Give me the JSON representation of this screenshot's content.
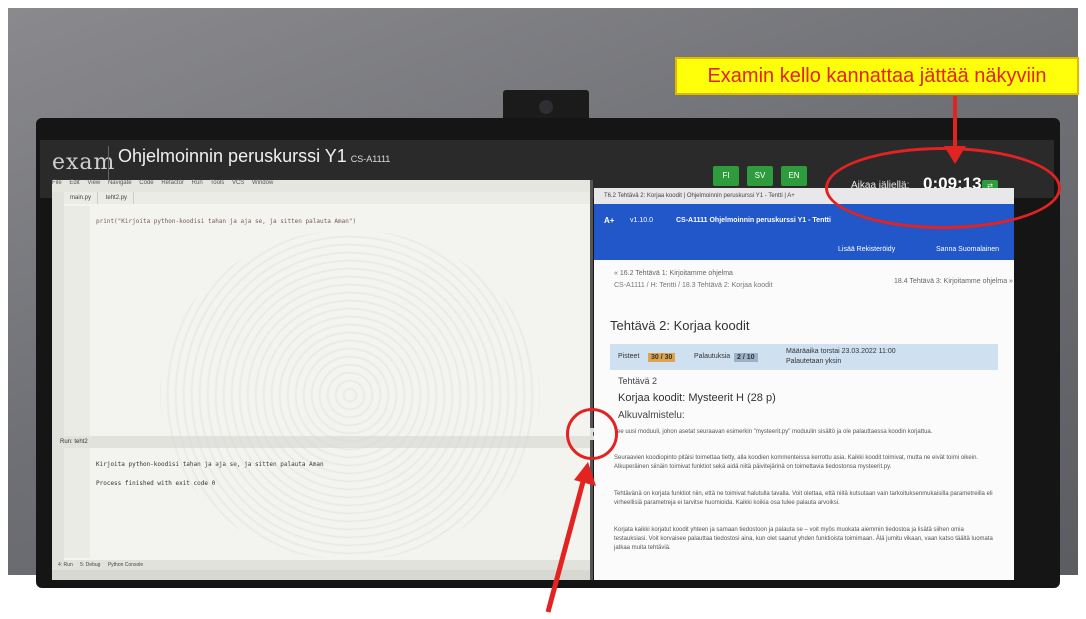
{
  "annotation": {
    "callout_text": "Examin kello kannattaa jättää näkyviin"
  },
  "exam": {
    "brand": "exam",
    "course_title": "Ohjelmoinnin peruskurssi Y1",
    "course_code": "CS-A1111",
    "languages": [
      "FI",
      "SV",
      "EN"
    ],
    "timer_label": "Aikaa jäljellä:",
    "timer_value": "0:09:13"
  },
  "ide": {
    "menu": [
      "File",
      "Edit",
      "View",
      "Navigate",
      "Code",
      "Refactor",
      "Run",
      "Tools",
      "VCS",
      "Window"
    ],
    "tabs": [
      "main.py",
      "teht2.py"
    ],
    "code_line": "print(\"Kirjoita python-koodisi tahan ja aja se, ja sitten palauta Aman\")",
    "run_tab": "Run: teht2",
    "output_lines": [
      "Kirjoita python-koodisi tahan ja aja se, ja sitten palauta Aman",
      "Process finished with exit code 0"
    ],
    "bottom_tabs": [
      "4: Run",
      "5: Debug",
      "Python Console"
    ]
  },
  "browser": {
    "window_title": "T6.2 Tehtävä 2: Korjaa koodit | Ohjelmoinnin peruskurssi Y1 - Tentti | A+",
    "logo": "A+",
    "version": "v1.10.0",
    "course": "CS-A1111 Ohjelmoinnin peruskurssi Y1 - Tentti",
    "language_menu": "Lisää Rekisteröidy",
    "user_menu": "Sanna Suomalainen",
    "crumb_prev": "« 16.2 Tehtävä 1: Kirjoitamme ohjelma",
    "crumb_next": "18.4 Tehtävä 3: Kirjoitamme ohjelma »",
    "crumb_path": "CS-A1111 / H: Tentti / 18.3 Tehtävä 2: Korjaa koodit",
    "heading": "Tehtävä 2: Korjaa koodit",
    "points_label": "Pisteet",
    "points_value": "30 / 30",
    "submissions_label": "Palautuksia",
    "submissions_value": "2 / 10",
    "deadline": "Määräaika torstai 23.03.2022 11:00",
    "group": "Palautetaan yksin",
    "task_label": "Tehtävä 2",
    "task_title": "Korjaa koodit: Mysteerit H (28 p)",
    "section": "Alkuvalmistelu:",
    "paragraphs": [
      "Tee uusi moduuli, johon asetat seuraavan esimerkin \"mysteerit.py\" moduulin sisältö ja ole palauttaessa koodin korjattua.",
      "Seuraavien koodiopinto pitäisi toimettaa tietty, alla koodien kommenteissa kerrottu asia. Kaikki koodit toimivat, mutta ne eivät toimi oikein. Alkuperäinen siinäin toimivat funktiot sekä aidä niitä päivitejärinä on toimettavia tiedostonsa mysteerit.py.",
      "Tehtävänä on korjata funktiot niin, että ne toimivat halutulla tavalla. Voit olettaa, että niitä kutsutaan vain tarkoituksenmukaisilla parametreilla eli virheellisiä parametreja ei tarvitse huomioida. Kaikki koikia osa tulee palauta arvoiksi.",
      "Korjata kaikki korjatut koodit yhteen ja samaan tiedostoon ja palauta se – voit myös muokata aiemmin tiedostoa ja lisätä siihen omia testauksiasi. Voit korvaisee palauttaa tiedostosi aina, kun olet saanut yhden funktioista toimimaan. Älä jumitu vikaan, vaan katso täältä luomata jatkaa muita tehtäviä."
    ]
  }
}
